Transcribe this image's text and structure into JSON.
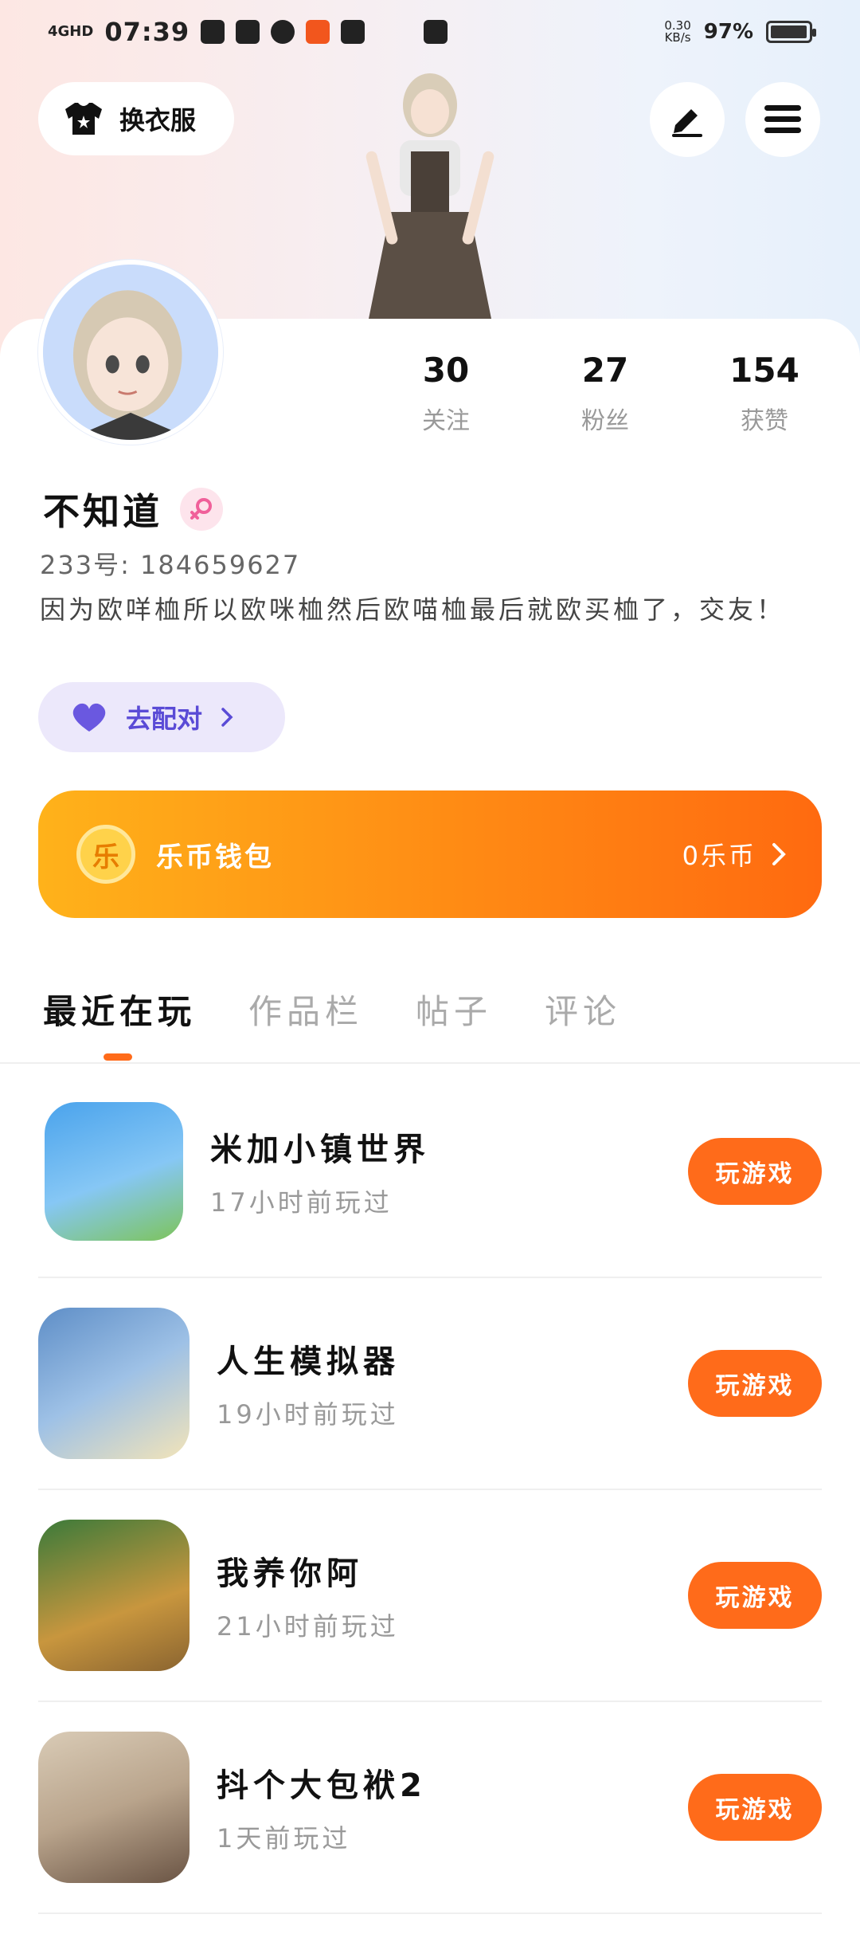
{
  "status_bar": {
    "network": "4GHD",
    "time": "07:39",
    "speed_value": "0.30",
    "speed_unit": "KB/s",
    "battery": "97%"
  },
  "header": {
    "dress_label": "换衣服",
    "edit_icon": "pen-icon",
    "menu_icon": "hamburger-icon"
  },
  "profile": {
    "stats": [
      {
        "value": "30",
        "label": "关注"
      },
      {
        "value": "27",
        "label": "粉丝"
      },
      {
        "value": "154",
        "label": "获赞"
      }
    ],
    "name": "不知道",
    "gender_icon": "female-icon",
    "uid": "233号: 184659627",
    "bio": "因为欧咩桖所以欧咪桖然后欧喵桖最后就欧买桖了，交友！",
    "match_label": "去配对"
  },
  "wallet": {
    "coin_char": "乐",
    "title": "乐币钱包",
    "balance": "0乐币"
  },
  "tabs": [
    "最近在玩",
    "作品栏",
    "帖子",
    "评论"
  ],
  "games": [
    {
      "name": "米加小镇世界",
      "time": "17小时前玩过",
      "button": "玩游戏",
      "colors": [
        "#4aa3ec",
        "#7dc45a"
      ]
    },
    {
      "name": "人生模拟器",
      "time": "19小时前玩过",
      "button": "玩游戏",
      "colors": [
        "#5e8ec7",
        "#f3e4b8"
      ]
    },
    {
      "name": "我养你阿",
      "time": "21小时前玩过",
      "button": "玩游戏",
      "colors": [
        "#3b7a3a",
        "#c8963e"
      ]
    },
    {
      "name": "抖个大包袱2",
      "time": "1天前玩过",
      "button": "玩游戏",
      "colors": [
        "#b9a48c",
        "#6a5444"
      ]
    }
  ],
  "colors": {
    "accent": "#ff6b1a",
    "wallet_start": "#ffb21a",
    "match_bg": "#ece8fb",
    "match_text": "#5a4bd6"
  }
}
